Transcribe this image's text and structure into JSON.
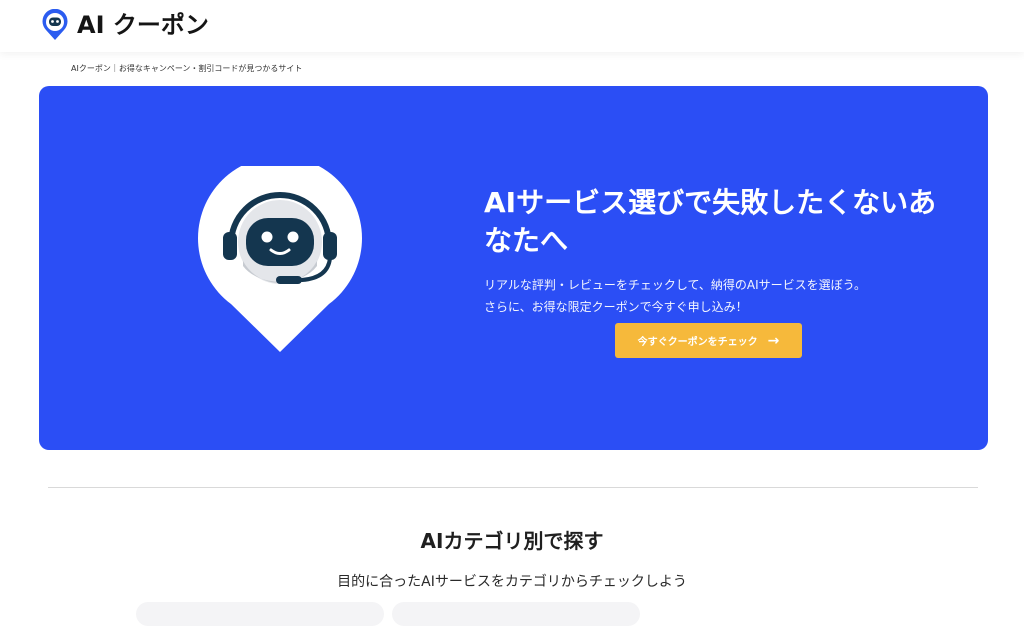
{
  "header": {
    "logo_text": "AI クーポン",
    "logo_icon": "robot-map-pin-icon"
  },
  "breadcrumb": "AIクーポン｜お得なキャンペーン・割引コードが見つかるサイト",
  "hero": {
    "title": "AIサービス選びで失敗したくないあなたへ",
    "desc_line1": "リアルな評判・レビューをチェックして、納得のAIサービスを選ぼう。",
    "desc_line2": "さらに、お得な限定クーポンで今すぐ申し込み！",
    "cta_label": "今すぐクーポンをチェック",
    "cta_icon": "arrow-right-icon",
    "illustration_icon": "robot-headset-pin-icon"
  },
  "section": {
    "title": "AIカテゴリ別で探す",
    "subtitle": "目的に合ったAIサービスをカテゴリからチェックしよう"
  },
  "colors": {
    "hero_bg": "#2b4ef5",
    "cta_bg": "#f6b93b",
    "logo_blue": "#2b5cf0",
    "robot_dark": "#14364f"
  }
}
